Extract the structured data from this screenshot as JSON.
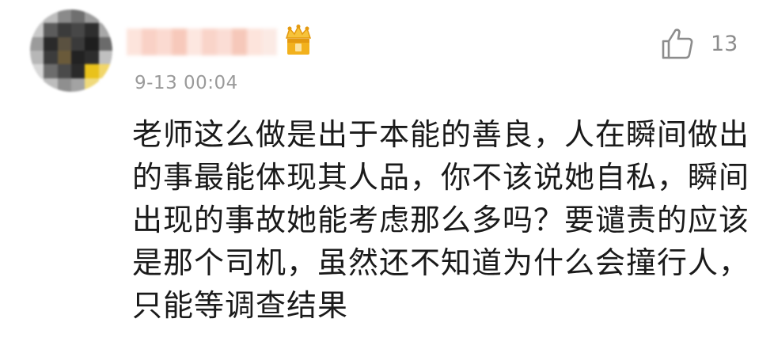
{
  "comment": {
    "username": "user",
    "timestamp": "9-13 00:04",
    "like": {
      "icon": "thumbs-up-icon",
      "count": "13"
    },
    "badge_icon": "crown-badge-icon",
    "text_lines": [
      "老师这么做是出于本能的善良，人在瞬间做出",
      "的事最能体现其人品，你不该说她自私，瞬间",
      "出现的事故她能考虑那么多吗？要谴责的应该",
      "是那个司机，虽然还不知道为什么会撞行人，",
      "只能等调查结果"
    ]
  },
  "colors": {
    "background": "#ffffff",
    "text": "#1a1a1a",
    "meta_gray": "#9a9a9a",
    "badge_gold": "#f2b11d",
    "username_blur": "#f9d2c8"
  }
}
